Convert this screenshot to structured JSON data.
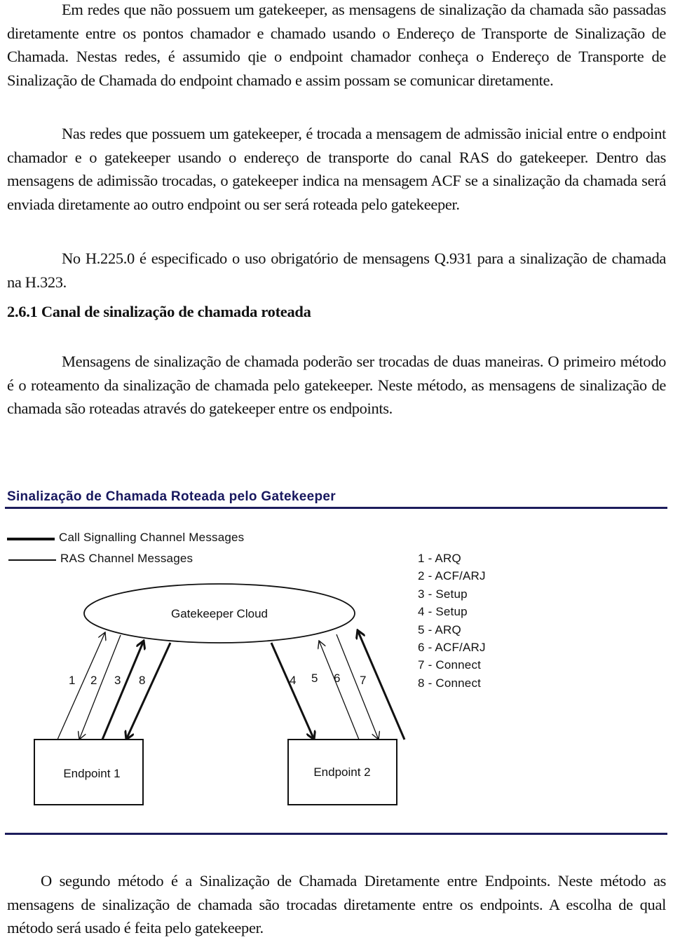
{
  "paragraphs": {
    "p1": "Em redes que não possuem um gatekeeper, as mensagens de sinalização da chamada são passadas diretamente entre os pontos chamador e chamado usando o Endereço de Transporte de Sinalização de Chamada. Nestas redes,  é assumido qie o endpoint chamador conheça o Endereço de Transporte de Sinalização de Chamada do endpoint chamado e assim possam se comunicar diretamente.",
    "p2": "Nas redes que possuem um gatekeeper, é trocada a mensagem de admissão inicial entre o endpoint chamador e o gatekeeper usando o endereço de transporte do canal RAS do gatekeeper. Dentro das mensagens de adimissão trocadas, o gatekeeper indica na mensagem ACF se a sinalização da chamada será enviada diretamente  ao outro endpoint ou ser será roteada pelo gatekeeper.",
    "p3": "No H.225.0 é especificado o uso obrigatório de mensagens Q.931 para a sinalização de chamada na H.323.",
    "p4": "Mensagens de sinalização de chamada poderão ser trocadas de duas maneiras. O primeiro método é o roteamento da sinalização de chamada pelo gatekeeper. Neste método, as mensagens de sinalização de chamada são roteadas através do gatekeeper entre os endpoints.",
    "p5": "O segundo método é a Sinalização de Chamada Diretamente entre Endpoints. Neste método as mensagens de sinalização de chamada são trocadas diretamente entre os endpoints. A escolha de qual método será usado é feita pelo gatekeeper."
  },
  "section_heading": "2.6.1  Canal de sinalização de chamada roteada",
  "figure": {
    "title": "Sinalização de Chamada Roteada pelo Gatekeeper",
    "title_color": "#17175e",
    "rule_color": "#1d1d5c",
    "legend": [
      {
        "style": "thick",
        "label": "Call Signalling Channel Messages"
      },
      {
        "style": "thin",
        "label": "RAS Channel Messages"
      }
    ],
    "cloud_label": "Gatekeeper Cloud",
    "endpoints": [
      "Endpoint 1",
      "Endpoint 2"
    ],
    "arrows": [
      {
        "number": "1",
        "endpoint": 1,
        "direction": "to-gatekeeper",
        "channel": "RAS"
      },
      {
        "number": "2",
        "endpoint": 1,
        "direction": "to-endpoint",
        "channel": "RAS"
      },
      {
        "number": "3",
        "endpoint": 1,
        "direction": "to-gatekeeper",
        "channel": "Call Signalling"
      },
      {
        "number": "8",
        "endpoint": 1,
        "direction": "to-endpoint",
        "channel": "Call Signalling"
      },
      {
        "number": "4",
        "endpoint": 2,
        "direction": "to-endpoint",
        "channel": "Call Signalling"
      },
      {
        "number": "5",
        "endpoint": 2,
        "direction": "to-gatekeeper",
        "channel": "RAS"
      },
      {
        "number": "6",
        "endpoint": 2,
        "direction": "to-endpoint",
        "channel": "RAS"
      },
      {
        "number": "7",
        "endpoint": 2,
        "direction": "to-gatekeeper",
        "channel": "Call Signalling"
      }
    ],
    "messages": [
      "1 - ARQ",
      "2 - ACF/ARJ",
      "3 - Setup",
      "4 - Setup",
      "5 - ARQ",
      "6 - ACF/ARJ",
      "7 - Connect",
      "8 - Connect"
    ]
  }
}
